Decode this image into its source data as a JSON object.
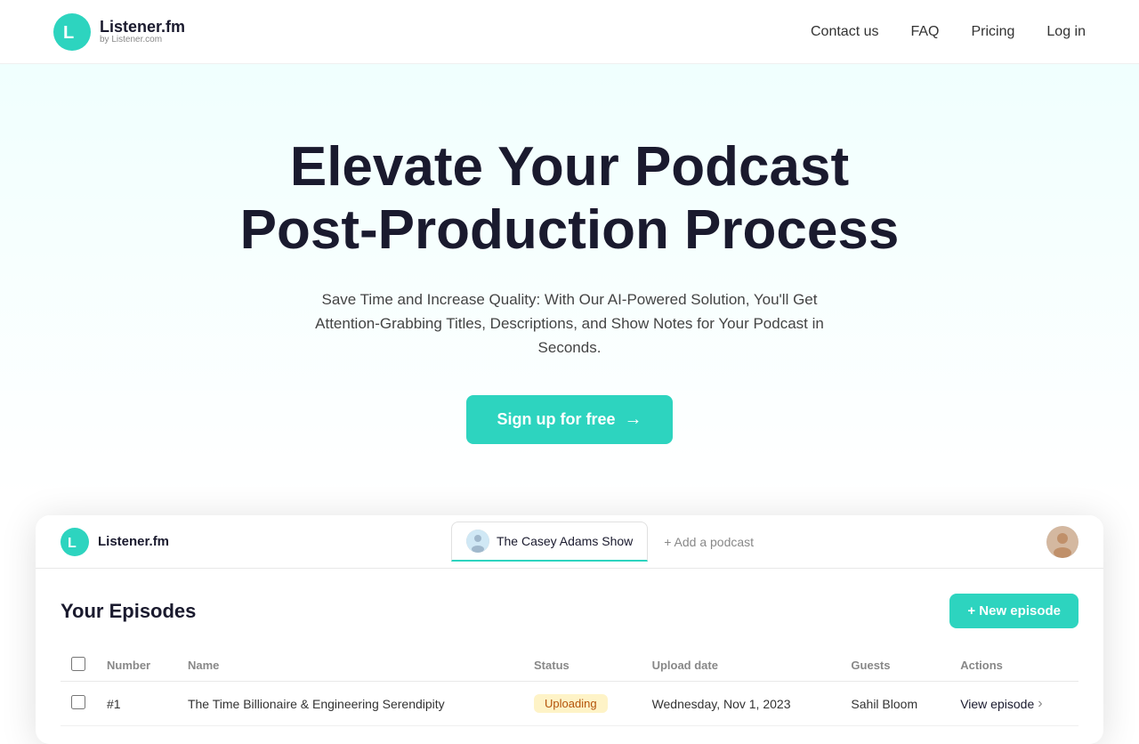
{
  "nav": {
    "logo_main": "Listener.fm",
    "logo_sub": "by Listener.com",
    "links": [
      {
        "label": "Contact us",
        "id": "contact-us"
      },
      {
        "label": "FAQ",
        "id": "faq"
      },
      {
        "label": "Pricing",
        "id": "pricing"
      },
      {
        "label": "Log in",
        "id": "login"
      }
    ]
  },
  "hero": {
    "heading_line1": "Elevate Your Podcast",
    "heading_line2": "Post-Production Process",
    "subtext": "Save Time and Increase Quality: With Our AI-Powered Solution, You'll Get Attention-Grabbing Titles, Descriptions, and Show Notes for Your Podcast in Seconds.",
    "cta_label": "Sign up for free"
  },
  "app": {
    "logo_label": "Listener.fm",
    "podcast_tab_label": "The Casey Adams Show",
    "add_podcast_label": "+ Add a podcast",
    "episodes_title": "Your Episodes",
    "new_episode_label": "+ New episode",
    "table": {
      "columns": [
        "",
        "Number",
        "Name",
        "Status",
        "Upload date",
        "Guests",
        "Actions"
      ],
      "rows": [
        {
          "number": "#1",
          "name": "The Time Billionaire & Engineering Serendipity",
          "status": "Uploading",
          "upload_date": "Wednesday, Nov 1, 2023",
          "guests": "Sahil Bloom",
          "action_label": "View episode"
        }
      ]
    }
  }
}
